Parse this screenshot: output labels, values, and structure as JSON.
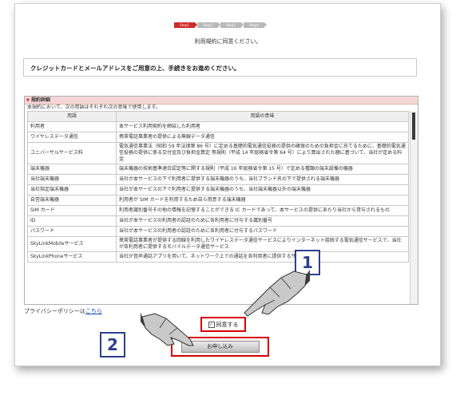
{
  "steps": [
    "Step1",
    "Step2",
    "Step3",
    "Step4"
  ],
  "instruction": "利用規約に同意ください。",
  "notice": "クレジットカードとメールアドレスをご用意の上、手続きをお進めください。",
  "terms": {
    "header": "規約詳細",
    "intro": "本規約において、次の用語はそれぞれ次の意味で使用します。",
    "columns": [
      "用語",
      "用語の意味"
    ],
    "rows": [
      {
        "term": "利用者",
        "meaning": "本サービス利用契約を締結した利用者"
      },
      {
        "term": "ワイヤレスデータ通信",
        "meaning": "携帯電話事業者の提供による無線データ通信"
      },
      {
        "term": "ユニバーサルサービス料",
        "meaning": "電気通信事業法（昭和 59 年法律第 86 号）に定める基礎的電気通信役務の提供の確保のための負担金に充てるために、基礎的電気通信役務の提供に係る交付金及び負担金算定 等規則（平成 14 年総務省令第 64 号）により算出された額に基づいて、当社が定める料金"
      },
      {
        "term": "端末機器",
        "meaning": "端末機器の技術基準適合認定等に関する規則（平成 16 年総務省令第 15 号）で定める種類の端末設備の機器"
      },
      {
        "term": "当社端末機器",
        "meaning": "当社が本サービスの下で利用者に提供する端末機器のうち、当社ブランド名の下で提供される端末機器"
      },
      {
        "term": "当社指定端末機器",
        "meaning": "当社が本サービスの下で利用者に提供する端末機器のうち、当社端末機器以外の端末機器"
      },
      {
        "term": "自営端末機器",
        "meaning": "利用者が SIM カードを利用するため自ら用意する端末機器"
      },
      {
        "term": "SIM カード",
        "meaning": "利用者識別番号その他の情報を記憶することができる IC カードであって、本サービスの提供にあたり当社から貸与されるもの"
      },
      {
        "term": "ID",
        "meaning": "当社が本サービスの利用者の認証のために各利用者に付与する識別番号"
      },
      {
        "term": "パスワード",
        "meaning": "当社が本サービスの利用者の認証のために各利用者に付与するパスワード"
      },
      {
        "term": "SkyLinkMobileサービス",
        "meaning": "携帯電話事業者が提供する回線を利用したワイヤレスデータ通信サービスによりインターネット接続する電気通信サービスで、当社が各利用者に提供するモバイルデータ通信サービス"
      },
      {
        "term": "SkyLinkPhoneサービス",
        "meaning": "当社が音声通話アプリを用いて、ネットワーク上での通話を各利用者に提供するサービス"
      }
    ]
  },
  "privacy": {
    "prefix": "プライバシーポリシーは",
    "link": "こちら"
  },
  "agree": {
    "label": "同意する",
    "checked": true,
    "checkmark": "✓"
  },
  "apply_button": "お申し込み",
  "annotations": [
    "1",
    "2"
  ]
}
